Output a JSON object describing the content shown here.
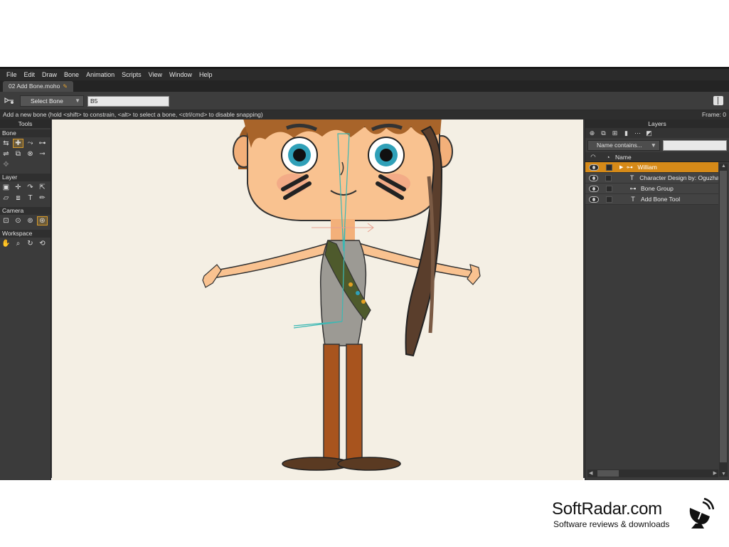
{
  "menubar": {
    "items": [
      "File",
      "Edit",
      "Draw",
      "Bone",
      "Animation",
      "Scripts",
      "View",
      "Window",
      "Help"
    ]
  },
  "document_tab": {
    "label": "02 Add Bone.moho"
  },
  "toolbar": {
    "select_bone_label": "Select Bone",
    "bone_name_value": "B5"
  },
  "statusline": {
    "hint": "Add a new bone (hold <shift> to constrain, <alt> to select a bone, <ctrl/cmd> to disable snapping)",
    "frame": "Frame: 0"
  },
  "tools_panel": {
    "title": "Tools",
    "sections": {
      "bone": "Bone",
      "layer": "Layer",
      "camera": "Camera",
      "workspace": "Workspace"
    }
  },
  "layers_panel": {
    "title": "Layers",
    "filter_label": "Name contains...",
    "name_header": "Name",
    "rows": [
      {
        "name": "William",
        "type": "bone-group",
        "selected": true
      },
      {
        "name": "Character Design by: Oguzhan",
        "type": "text",
        "selected": false
      },
      {
        "name": "Bone Group",
        "type": "bone-group",
        "selected": false
      },
      {
        "name": "Add Bone Tool",
        "type": "text",
        "selected": false
      }
    ]
  },
  "watermark": {
    "title": "SoftRadar.com",
    "subtitle": "Software reviews & downloads"
  },
  "colors": {
    "accent": "#d68a18",
    "canvas": "#f4efe4",
    "panel": "#3b3b3b",
    "bone": "#3bb8b4"
  }
}
